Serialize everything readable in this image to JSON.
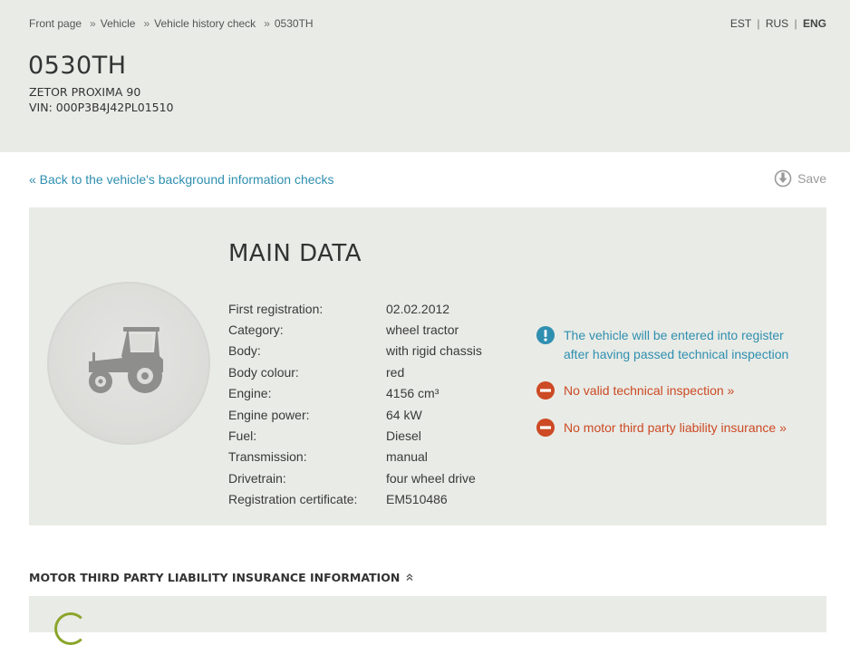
{
  "breadcrumb": [
    "Front page",
    "Vehicle",
    "Vehicle history check",
    "0530TH"
  ],
  "languages": {
    "est": "EST",
    "rus": "RUS",
    "eng": "ENG",
    "separator": "|"
  },
  "vehicle": {
    "plate": "0530TH",
    "model": "ZETOR PROXIMA 90",
    "vin": "VIN: 000P3B4J42PL01510"
  },
  "back_link": "« Back to the vehicle's background information checks",
  "save_label": "Save",
  "main_data": {
    "title": "MAIN DATA",
    "rows": [
      {
        "label": "First registration:",
        "value": "02.02.2012"
      },
      {
        "label": "Category:",
        "value": "wheel tractor"
      },
      {
        "label": "Body:",
        "value": "with rigid chassis"
      },
      {
        "label": "Body colour:",
        "value": "red"
      },
      {
        "label": "Engine:",
        "value": "4156 cm³"
      },
      {
        "label": "Engine power:",
        "value": "64 kW"
      },
      {
        "label": "Fuel:",
        "value": "Diesel"
      },
      {
        "label": "Transmission:",
        "value": "manual"
      },
      {
        "label": "Drivetrain:",
        "value": "four wheel drive"
      },
      {
        "label": "Registration certificate:",
        "value": "EM510486"
      }
    ]
  },
  "alerts": [
    {
      "type": "info",
      "icon": "exclamation-info-icon",
      "text": "The vehicle will be entered into register after having passed technical inspection"
    },
    {
      "type": "warning",
      "icon": "no-entry-icon",
      "text": "No valid technical inspection »"
    },
    {
      "type": "warning",
      "icon": "no-entry-icon",
      "text": "No motor third party liability insurance »"
    }
  ],
  "insurance": {
    "heading": "MOTOR THIRD PARTY LIABILITY INSURANCE INFORMATION"
  },
  "colors": {
    "link": "#2f8fb0",
    "warning": "#cc4a24",
    "panel": "#e9ebe6"
  }
}
